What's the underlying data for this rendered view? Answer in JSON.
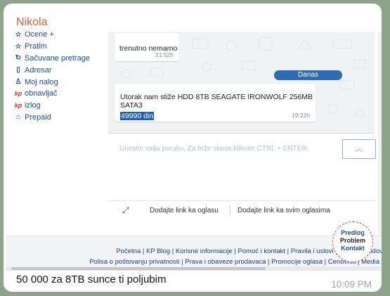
{
  "sender_name": "Nikola",
  "caption": "50 000 za 8TB sunce ti poljubim",
  "message_time": "10:09 PM",
  "screenshot": {
    "sidebar": {
      "items": [
        {
          "label": "Ocene +",
          "icon": "star-icon"
        },
        {
          "label": "Pratim",
          "icon": "star-icon"
        },
        {
          "label": "Sačuvane pretrage",
          "icon": "refresh-icon"
        },
        {
          "label": "Adresar",
          "icon": "book-icon"
        },
        {
          "label": "Moj nalog",
          "icon": "user-icon"
        },
        {
          "label": "obnavljač",
          "icon": "kp-icon"
        },
        {
          "label": "izlog",
          "icon": "kp-icon"
        },
        {
          "label": "Prepaid",
          "icon": "home-icon"
        }
      ]
    },
    "chat": {
      "msg1_text": "trenutno nemamo",
      "msg1_time": "21:52h",
      "date_label": "Danas",
      "msg2_text": "Utorak nam stiže HDD 8TB SEAGATE IRONWOLF 256MB SATA3",
      "msg2_price": "49990 din",
      "msg2_time": "19:22h"
    },
    "compose": {
      "placeholder": "Unesite vašu poruku. Za brže slanje kliknite CTRL + ENTER.",
      "send_icon": "chevron-up-icon",
      "link_ad": "Dodajte link ka oglasu",
      "link_all": "Dodajte link ka svim oglasima"
    },
    "footer": {
      "row1": "Početna | KP Blog | Korisne informacije | Pomoć i kontakt | Pravila i uslovi | Be... | Brendovi",
      "row2": "Polisa o poštovanju privatnosti | Prava i obaveze prodavaca | Promocije oglasa | Cenovnik | Media"
    },
    "badge": {
      "line1": "Predlog",
      "line2": "Problem",
      "line3": "Kontakt"
    }
  }
}
